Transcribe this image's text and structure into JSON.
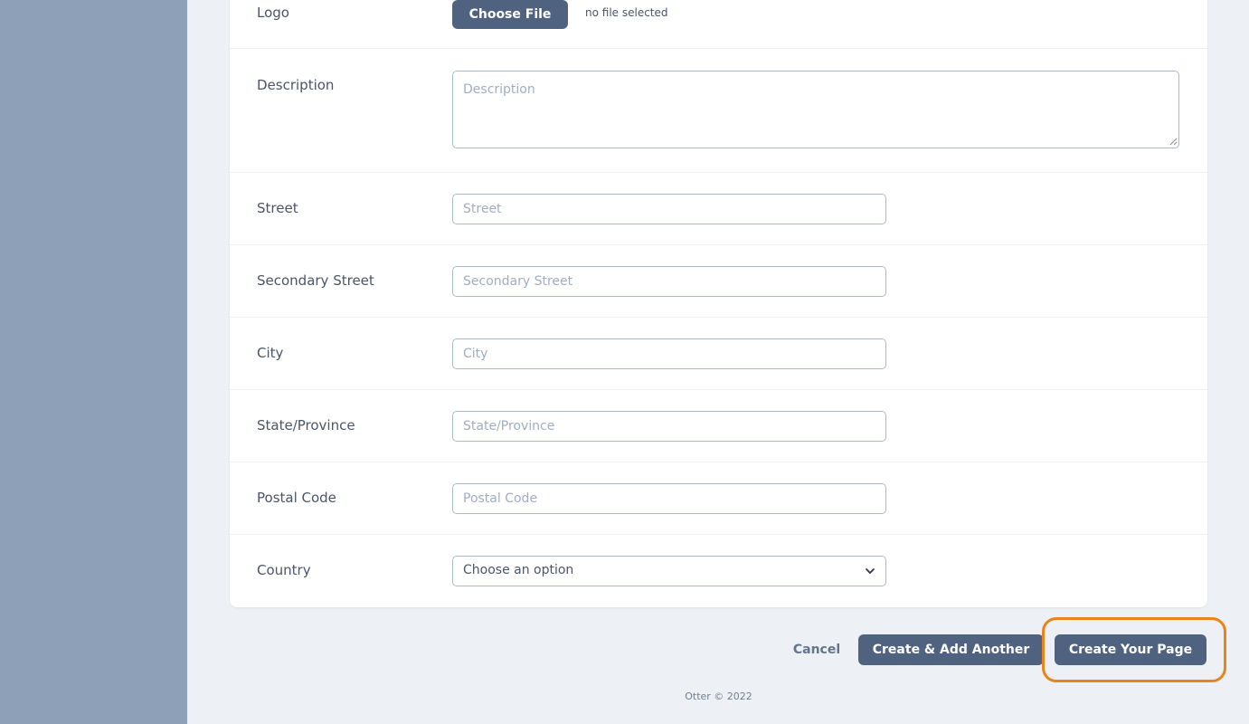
{
  "form": {
    "logo": {
      "label": "Logo",
      "button": "Choose File",
      "status": "no file selected"
    },
    "description": {
      "label": "Description",
      "placeholder": "Description",
      "value": ""
    },
    "street": {
      "label": "Street",
      "placeholder": "Street",
      "value": ""
    },
    "secondary_street": {
      "label": "Secondary Street",
      "placeholder": "Secondary Street",
      "value": ""
    },
    "city": {
      "label": "City",
      "placeholder": "City",
      "value": ""
    },
    "state": {
      "label": "State/Province",
      "placeholder": "State/Province",
      "value": ""
    },
    "postal_code": {
      "label": "Postal Code",
      "placeholder": "Postal Code",
      "value": ""
    },
    "country": {
      "label": "Country",
      "selected": "Choose an option",
      "icon": "chevron-down-icon"
    }
  },
  "actions": {
    "cancel": "Cancel",
    "create_add_another": "Create & Add Another",
    "create_page": "Create Your Page"
  },
  "footer": {
    "text": "Otter © 2022"
  },
  "colors": {
    "sidebar": "#8da0b8",
    "primary_button": "#4f6280",
    "highlight": "#e8841a",
    "background": "#edf0f4"
  }
}
